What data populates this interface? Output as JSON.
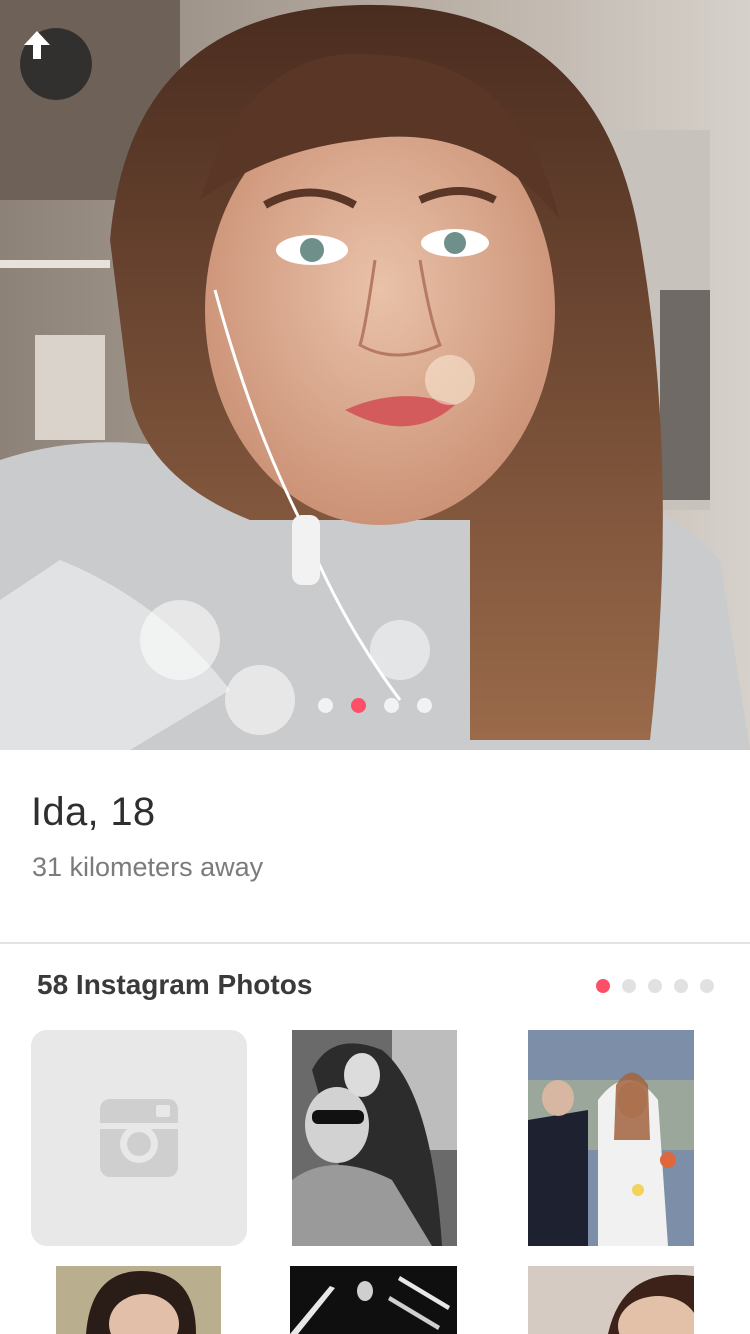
{
  "profile": {
    "name_age": "Ida, 18",
    "distance": "31 kilometers away",
    "photo_count": 4,
    "active_photo_index": 1
  },
  "instagram": {
    "title": "58 Instagram Photos",
    "page_count": 5,
    "active_page_index": 0
  },
  "colors": {
    "accent": "#fd5068",
    "text_primary": "#2f2f2f",
    "text_secondary": "#7b7b7b"
  },
  "icons": {
    "back": "arrow-up-icon",
    "placeholder": "instagram-icon"
  }
}
